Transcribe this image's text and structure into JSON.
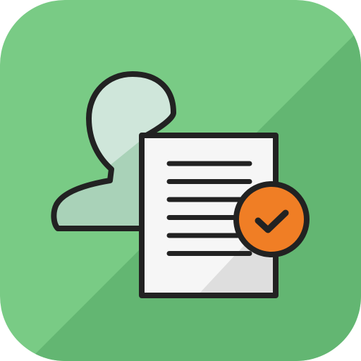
{
  "app_icon": {
    "icon_name": "user-document-approved-icon",
    "colors": {
      "background_light": "#79CB85",
      "background_dark": "#63B672",
      "outline": "#222222",
      "avatar_light": "#CFE6DA",
      "avatar_dark": "#A9D2B8",
      "paper": "#F6F6F6",
      "paper_shadow": "#DEDEDE",
      "document_lines": "#222222",
      "badge": "#F07E25",
      "check": "#222222"
    },
    "document_line_count": 6
  }
}
